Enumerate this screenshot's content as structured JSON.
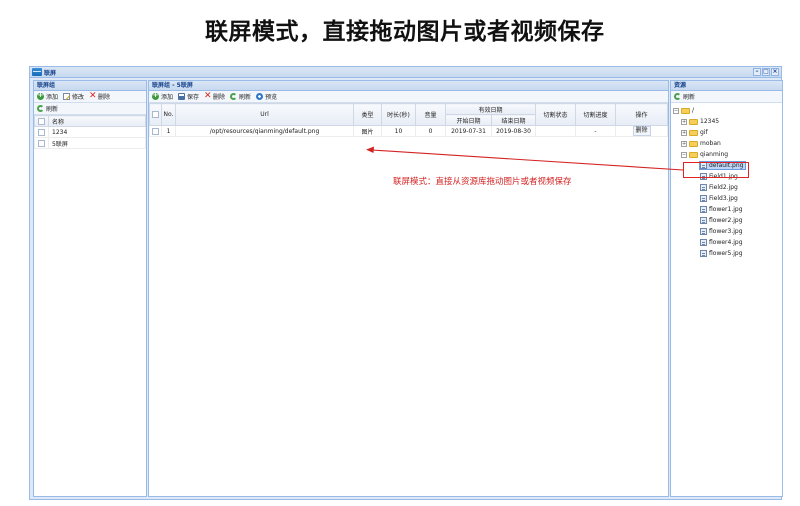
{
  "heading": "联屏模式，直接拖动图片或者视频保存",
  "window": {
    "title": "联屏",
    "controls": [
      "–",
      "□",
      "×"
    ]
  },
  "left_panel": {
    "title": "联屏组",
    "toolbar": {
      "add": "添加",
      "edit": "修改",
      "delete": "删除",
      "refresh": "刷新"
    },
    "column_name": "名称",
    "rows": [
      "1234",
      "5联屏"
    ]
  },
  "middle_panel": {
    "title": "联屏组 - 5联屏",
    "toolbar": {
      "add": "添加",
      "save": "保存",
      "delete": "删除",
      "refresh": "刷新",
      "preview": "预览"
    },
    "columns": {
      "no": "No.",
      "url": "Url",
      "type": "类型",
      "duration": "时长(秒)",
      "volume": "音量",
      "valid_date": "有效日期",
      "start_date": "开始日期",
      "end_date": "结束日期",
      "switch_status": "切割状态",
      "switch_progress": "切割进度",
      "operation": "操作"
    },
    "rows": [
      {
        "no": "1",
        "url": "/opt/resources/qianming/default.png",
        "type": "图片",
        "duration": "10",
        "volume": "0",
        "start_date": "2019-07-31",
        "end_date": "2019-08-30",
        "switch_status": "",
        "switch_progress": "-",
        "operation": "删除"
      }
    ]
  },
  "right_panel": {
    "title": "资源",
    "toolbar": {
      "refresh": "刷新"
    },
    "tree": {
      "root": "/",
      "folders": [
        "12345",
        "gif",
        "moban",
        "qianming"
      ],
      "files": [
        "default.png",
        "Field1.jpg",
        "Field2.jpg",
        "Field3.jpg",
        "flower1.jpg",
        "flower2.jpg",
        "flower3.jpg",
        "flower4.jpg",
        "flower5.jpg"
      ]
    }
  },
  "annotation": "联屏模式：直接从资源库拖动图片或者视频保存",
  "colors": {
    "annotation": "#d42323",
    "panel_header": "#c7d9f0",
    "selected_node": "#bdd6f7"
  }
}
